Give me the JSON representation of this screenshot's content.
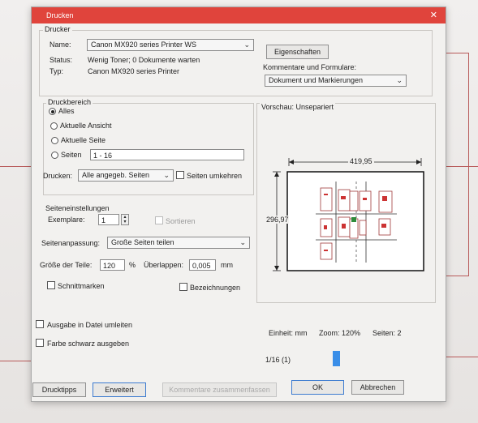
{
  "window": {
    "title": "Drucken",
    "close_glyph": "✕"
  },
  "printer": {
    "group_label": "Drucker",
    "name_label": "Name:",
    "name_value": "Canon MX920 series Printer WS",
    "status_label": "Status:",
    "status_value": "Wenig Toner; 0 Dokumente warten",
    "type_label": "Typ:",
    "type_value": "Canon MX920 series Printer",
    "properties_button": "Eigenschaften",
    "comments_label": "Kommentare und Formulare:",
    "comments_value": "Dokument und Markierungen"
  },
  "range": {
    "group_label": "Druckbereich",
    "all": "Alles",
    "current_view": "Aktuelle Ansicht",
    "current_page": "Aktuelle Seite",
    "pages": "Seiten",
    "pages_value": "1 - 16",
    "print_label": "Drucken:",
    "print_value": "Alle angegeb. Seiten",
    "reverse": "Seiten umkehren"
  },
  "page_settings": {
    "group_label": "Seiteneinstellungen",
    "copies_label": "Exemplare:",
    "copies_value": "1",
    "collate": "Sortieren",
    "scaling_label": "Seitenanpassung:",
    "scaling_value": "Große Seiten teilen",
    "tile_size_label": "Größe der Teile:",
    "tile_size_value": "120",
    "percent": "%",
    "overlap_label": "Überlappen:",
    "overlap_value": "0,005",
    "overlap_unit": "mm",
    "cut_marks": "Schnittmarken",
    "labels": "Bezeichnungen"
  },
  "output": {
    "to_file": "Ausgabe in Datei umleiten",
    "grayscale": "Farbe schwarz ausgeben"
  },
  "preview": {
    "label": "Vorschau: Unsepariert",
    "width_value": "419,95",
    "height_value": "296,97",
    "unit_text": "Einheit: mm",
    "zoom_text": "Zoom: 120%",
    "pages_text": "Seiten: 2",
    "page_indicator": "1/16 (1)"
  },
  "buttons": {
    "tips": "Drucktipps",
    "advanced": "Erweitert",
    "summarize": "Kommentare zusammenfassen",
    "ok": "OK",
    "cancel": "Abbrechen"
  },
  "colors": {
    "title_bar": "#e0443c",
    "accent": "#3a8ee8"
  }
}
